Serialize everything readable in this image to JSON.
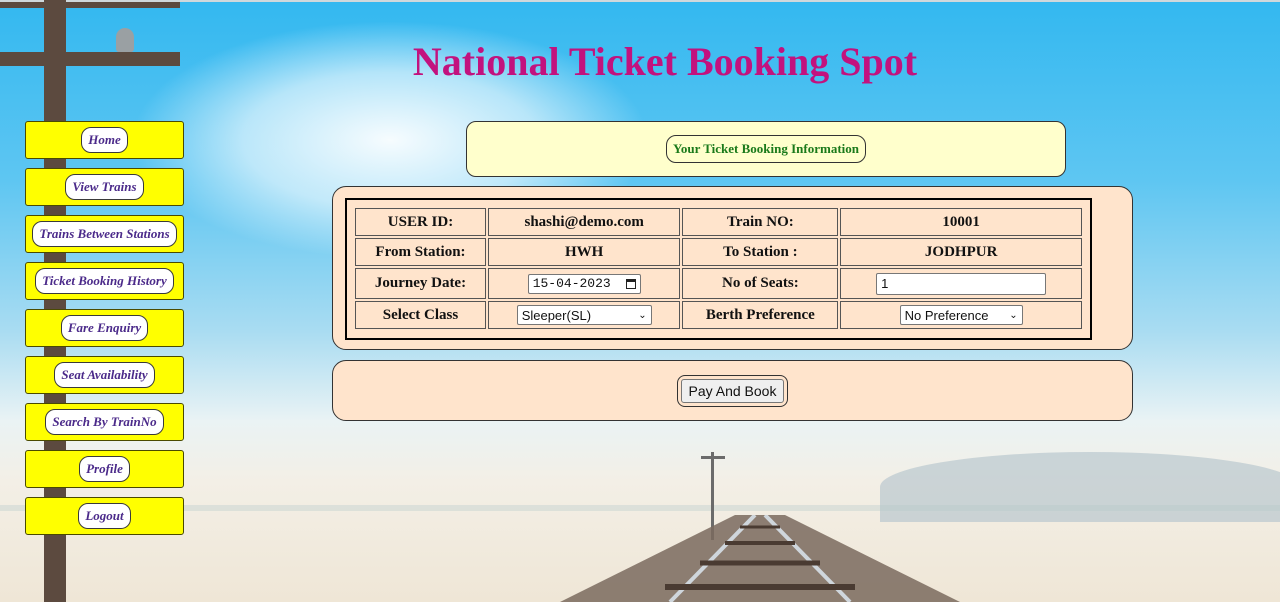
{
  "page": {
    "title": "National Ticket Booking Spot"
  },
  "menu": {
    "items": [
      {
        "label": "Home"
      },
      {
        "label": "View Trains"
      },
      {
        "label": "Trains Between Stations"
      },
      {
        "label": "Ticket Booking History"
      },
      {
        "label": "Fare Enquiry"
      },
      {
        "label": "Seat Availability"
      },
      {
        "label": "Search By TrainNo"
      },
      {
        "label": "Profile"
      },
      {
        "label": "Logout"
      }
    ]
  },
  "info": {
    "label": "Your Ticket Booking Information"
  },
  "form": {
    "user_id_label": "USER ID:",
    "user_id_value": "shashi@demo.com",
    "train_no_label": "Train NO:",
    "train_no_value": "10001",
    "from_label": "From Station:",
    "from_value": "HWH",
    "to_label": "To Station :",
    "to_value": "JODHPUR",
    "journey_date_label": "Journey Date:",
    "journey_date_value": "15-04-2023",
    "seats_label": "No of Seats:",
    "seats_value": "1",
    "class_label": "Select Class",
    "class_value": "Sleeper(SL)",
    "berth_label": "Berth Preference",
    "berth_value": "No Preference"
  },
  "actions": {
    "pay_label": "Pay And Book"
  },
  "icons": {
    "calendar": "calendar-icon",
    "dropdown": "chevron-down-icon"
  },
  "colors": {
    "title": "#c2127e",
    "menu_bg": "#ffff00",
    "menu_text": "#4b2a8a",
    "info_bg": "#ffffcc",
    "info_text": "#1a7a1a",
    "form_bg": "#ffe4cc"
  }
}
